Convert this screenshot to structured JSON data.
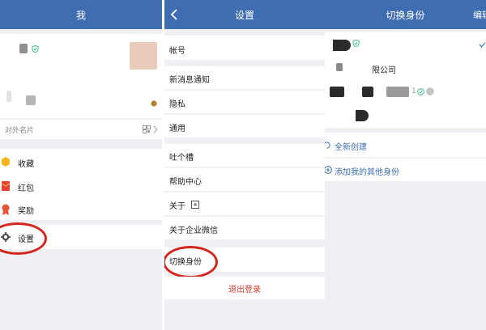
{
  "panel_me": {
    "title": "我",
    "business_card_label": "对外名片",
    "menu": [
      {
        "label": "收藏",
        "icon": "cube-icon",
        "color": "#f5b51b"
      },
      {
        "label": "红包",
        "icon": "red-envelope-icon",
        "color": "#e6402e"
      },
      {
        "label": "奖励",
        "icon": "medal-icon",
        "color": "#e6543a"
      },
      {
        "label": "设置",
        "icon": "gear-icon",
        "color": "#4a4a4a"
      }
    ]
  },
  "panel_settings": {
    "title": "设置",
    "items": [
      "帐号",
      "新消息通知",
      "隐私",
      "通用",
      "吐个槽",
      "帮助中心",
      "关于",
      "关于企业微信",
      "切换身份"
    ],
    "logout_label": "退出登录",
    "logout_color": "#d33a2c"
  },
  "panel_switch": {
    "title": "切换身份",
    "edit_label": "编辑",
    "company_suffix": "限公司",
    "member_count": "1",
    "create_new_label": "全新创建",
    "add_identity_label": "添加我的其他身份",
    "link_color": "#3e6db1"
  },
  "colors": {
    "header": "#3e6db1",
    "annotation": "#d3261f",
    "check": "#2db67c"
  }
}
